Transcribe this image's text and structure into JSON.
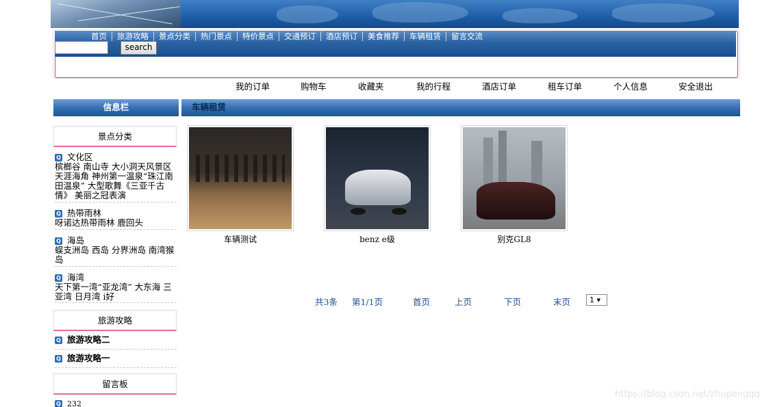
{
  "nav": {
    "items": [
      "首页",
      "旅游攻略",
      "景点分类",
      "热门景点",
      "特价景点",
      "交通预订",
      "酒店预订",
      "美食推荐",
      "车辆租赁",
      "留言交流"
    ],
    "search_button": "search",
    "search_value": ""
  },
  "user_links": [
    "我的订单",
    "购物车",
    "收藏夹",
    "我的行程",
    "酒店订单",
    "租车订单",
    "个人信息",
    "安全退出"
  ],
  "sidebar": {
    "title": "信息栏",
    "categories_title": "景点分类",
    "categories": [
      {
        "name": "文化区",
        "places": "槟榔谷  南山寺  大小洞天风景区  天涯海角  神州第一温泉“珠江南田温泉”  大型歌舞《三亚千古情》  美丽之冠表演"
      },
      {
        "name": "热带雨林",
        "places": "呀诺达热带雨林  鹿回头"
      },
      {
        "name": "海岛",
        "places": "蜈支洲岛  西岛  分界洲岛  南湾猴岛"
      },
      {
        "name": "海湾",
        "places": "天下第一湾“亚龙湾”  大东海  三亚湾  日月湾  i好"
      }
    ],
    "guides_title": "旅游攻略",
    "guides": [
      "旅游攻略二",
      "旅游攻略一"
    ],
    "board_title": "留言板",
    "messages": [
      "232"
    ]
  },
  "main": {
    "title": "车辆租赁",
    "cars": [
      {
        "name": "车辆测试"
      },
      {
        "name": "benz e级"
      },
      {
        "name": "别克GL8"
      }
    ],
    "pager": {
      "total": "共3条",
      "page": "第1/1页",
      "first": "首页",
      "prev": "上页",
      "next": "下页",
      "last": "末页",
      "select": "1 ▾"
    }
  },
  "watermark": "https://blog.csdn.net/zhupengqq",
  "colors": {
    "header_blue": "#2a63a3",
    "accent_pink": "#e06aa6",
    "link_blue": "#1f4e8c"
  }
}
